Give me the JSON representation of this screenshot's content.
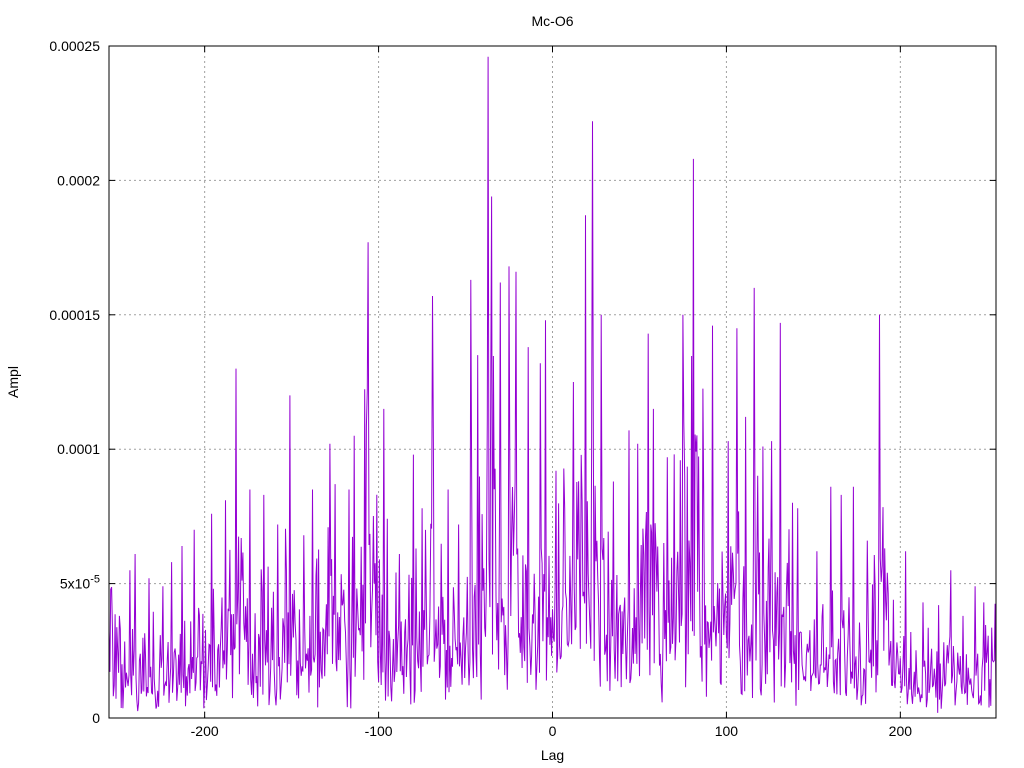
{
  "chart_data": {
    "type": "line",
    "title": "Mc-O6",
    "xlabel": "Lag",
    "ylabel": "Ampl",
    "xlim": [
      -255,
      255
    ],
    "ylim": [
      0,
      0.00025
    ],
    "x_ticks": [
      -200,
      -100,
      0,
      100,
      200
    ],
    "x_tick_labels": [
      "-200",
      "-100",
      "0",
      "100",
      "200"
    ],
    "y_ticks": [
      0,
      5e-05,
      0.0001,
      0.00015,
      0.0002,
      0.00025
    ],
    "y_tick_labels": [
      "0",
      "5x10-5",
      "0.0001",
      "0.00015",
      "0.0002",
      "0.00025"
    ],
    "grid": true,
    "color": "#9400d3",
    "peaks": [
      {
        "x": -249,
        "y": 3.8e-05
      },
      {
        "x": -243,
        "y": 5.5e-05
      },
      {
        "x": -240,
        "y": 6.1e-05
      },
      {
        "x": -232,
        "y": 5.2e-05
      },
      {
        "x": -224,
        "y": 4.9e-05
      },
      {
        "x": -219,
        "y": 5.8e-05
      },
      {
        "x": -213,
        "y": 6.4e-05
      },
      {
        "x": -206,
        "y": 7e-05
      },
      {
        "x": -196,
        "y": 7.6e-05
      },
      {
        "x": -188,
        "y": 8.1e-05
      },
      {
        "x": -182,
        "y": 0.00013
      },
      {
        "x": -174,
        "y": 8.5e-05
      },
      {
        "x": -166,
        "y": 8.3e-05
      },
      {
        "x": -158,
        "y": 7.2e-05
      },
      {
        "x": -151,
        "y": 0.00012
      },
      {
        "x": -143,
        "y": 6.8e-05
      },
      {
        "x": -138,
        "y": 8.5e-05
      },
      {
        "x": -128,
        "y": 0.000102
      },
      {
        "x": -125,
        "y": 8.7e-05
      },
      {
        "x": -117,
        "y": 8.5e-05
      },
      {
        "x": -114,
        "y": 0.000105
      },
      {
        "x": -106,
        "y": 0.000177
      },
      {
        "x": -97,
        "y": 0.000115
      },
      {
        "x": -88,
        "y": 6.1e-05
      },
      {
        "x": -80,
        "y": 9.8e-05
      },
      {
        "x": -75,
        "y": 7.8e-05
      },
      {
        "x": -69,
        "y": 0.000157
      },
      {
        "x": -60,
        "y": 8.5e-05
      },
      {
        "x": -54,
        "y": 7.2e-05
      },
      {
        "x": -47,
        "y": 0.000163
      },
      {
        "x": -43,
        "y": 0.000135
      },
      {
        "x": -37,
        "y": 0.000246
      },
      {
        "x": -35,
        "y": 0.000194
      },
      {
        "x": -30,
        "y": 0.000162
      },
      {
        "x": -25,
        "y": 0.000168
      },
      {
        "x": -21,
        "y": 0.000166
      },
      {
        "x": -14,
        "y": 0.000138
      },
      {
        "x": -7,
        "y": 0.000132
      },
      {
        "x": -4,
        "y": 0.000148
      },
      {
        "x": 2,
        "y": 9.2e-05
      },
      {
        "x": 12,
        "y": 0.000125
      },
      {
        "x": 19,
        "y": 0.000187
      },
      {
        "x": 23,
        "y": 0.000222
      },
      {
        "x": 28,
        "y": 0.00015
      },
      {
        "x": 35,
        "y": 8.8e-05
      },
      {
        "x": 44,
        "y": 0.000107
      },
      {
        "x": 49,
        "y": 0.000102
      },
      {
        "x": 55,
        "y": 0.000143
      },
      {
        "x": 58,
        "y": 0.000115
      },
      {
        "x": 66,
        "y": 9.7e-05
      },
      {
        "x": 75,
        "y": 0.00015
      },
      {
        "x": 81,
        "y": 0.000208
      },
      {
        "x": 92,
        "y": 0.000146
      },
      {
        "x": 101,
        "y": 0.000103
      },
      {
        "x": 106,
        "y": 0.000145
      },
      {
        "x": 111,
        "y": 0.000112
      },
      {
        "x": 116,
        "y": 0.00016
      },
      {
        "x": 121,
        "y": 0.000101
      },
      {
        "x": 126,
        "y": 0.000103
      },
      {
        "x": 131,
        "y": 0.000147
      },
      {
        "x": 141,
        "y": 7.8e-05
      },
      {
        "x": 152,
        "y": 6.2e-05
      },
      {
        "x": 160,
        "y": 8.6e-05
      },
      {
        "x": 166,
        "y": 8.3e-05
      },
      {
        "x": 173,
        "y": 8.6e-05
      },
      {
        "x": 181,
        "y": 6.6e-05
      },
      {
        "x": 188,
        "y": 0.00015
      },
      {
        "x": 196,
        "y": 4.4e-05
      },
      {
        "x": 203,
        "y": 6.2e-05
      },
      {
        "x": 213,
        "y": 4.3e-05
      },
      {
        "x": 222,
        "y": 4.2e-05
      },
      {
        "x": 229,
        "y": 5.5e-05
      },
      {
        "x": 236,
        "y": 3.8e-05
      },
      {
        "x": 243,
        "y": 4.9e-05
      },
      {
        "x": 248,
        "y": 4.3e-05
      }
    ]
  }
}
